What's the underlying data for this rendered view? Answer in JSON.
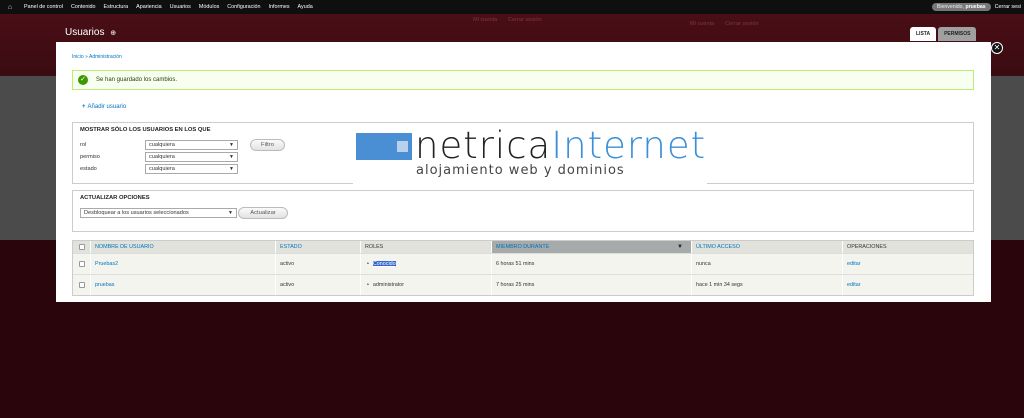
{
  "toolbar": {
    "items": [
      "Panel de control",
      "Contenido",
      "Estructura",
      "Apariencia",
      "Usuarios",
      "Módulos",
      "Configuración",
      "Informes",
      "Ayuda"
    ],
    "welcome_prefix": "Bienvenido,",
    "welcome_user": "pruebas",
    "logout": "Cerrar sesi"
  },
  "ghost_links": {
    "my_account": "Mi cuenta",
    "logout": "Cerrar sesión"
  },
  "overlay": {
    "title": "Usuarios",
    "tabs": [
      {
        "label": "LISTA",
        "active": true
      },
      {
        "label": "PERMISOS",
        "active": false
      }
    ],
    "close": "✕"
  },
  "breadcrumb": [
    "Inicio",
    "Administración"
  ],
  "breadcrumb_sep": " » ",
  "status_message": "Se han guardado los cambios.",
  "add_user_label": "Añadir usuario",
  "filter": {
    "title": "MOSTRAR SÓLO LOS USUARIOS EN LOS QUE",
    "rows": [
      {
        "label": "rol",
        "value": "cualquiera"
      },
      {
        "label": "permiso",
        "value": "cualquiera"
      },
      {
        "label": "estado",
        "value": "cualquiera"
      }
    ],
    "button": "Filtro"
  },
  "update": {
    "title": "ACTUALIZAR OPCIONES",
    "select_value": "Desbloquear a los usuarios seleccionados",
    "button": "Actualizar"
  },
  "table": {
    "headers": [
      "NOMBRE DE USUARIO",
      "ESTADO",
      "ROLES",
      "MIEMBRO DURANTE",
      "ÚLTIMO ACCESO",
      "OPERACIONES"
    ],
    "rows": [
      {
        "name": "Pruebas2",
        "status": "activo",
        "role": "Conocido",
        "member_for": "6 horas 51 mins",
        "last_access": "nunca",
        "op": "editar"
      },
      {
        "name": "pruebas",
        "status": "activo",
        "role": "administrator",
        "member_for": "7 horas 25 mins",
        "last_access": "hace 1 min 34 segs",
        "op": "editar"
      }
    ]
  },
  "logo": {
    "part1": "netrica",
    "part2": "Internet",
    "tagline": "alojamiento web y dominios",
    "colors": {
      "blue": "#3a8fd8",
      "dark": "#222222"
    }
  },
  "colors": {
    "link": "#0074bd",
    "status_bg": "#f8fff0",
    "backdrop": "#3a0e14"
  }
}
